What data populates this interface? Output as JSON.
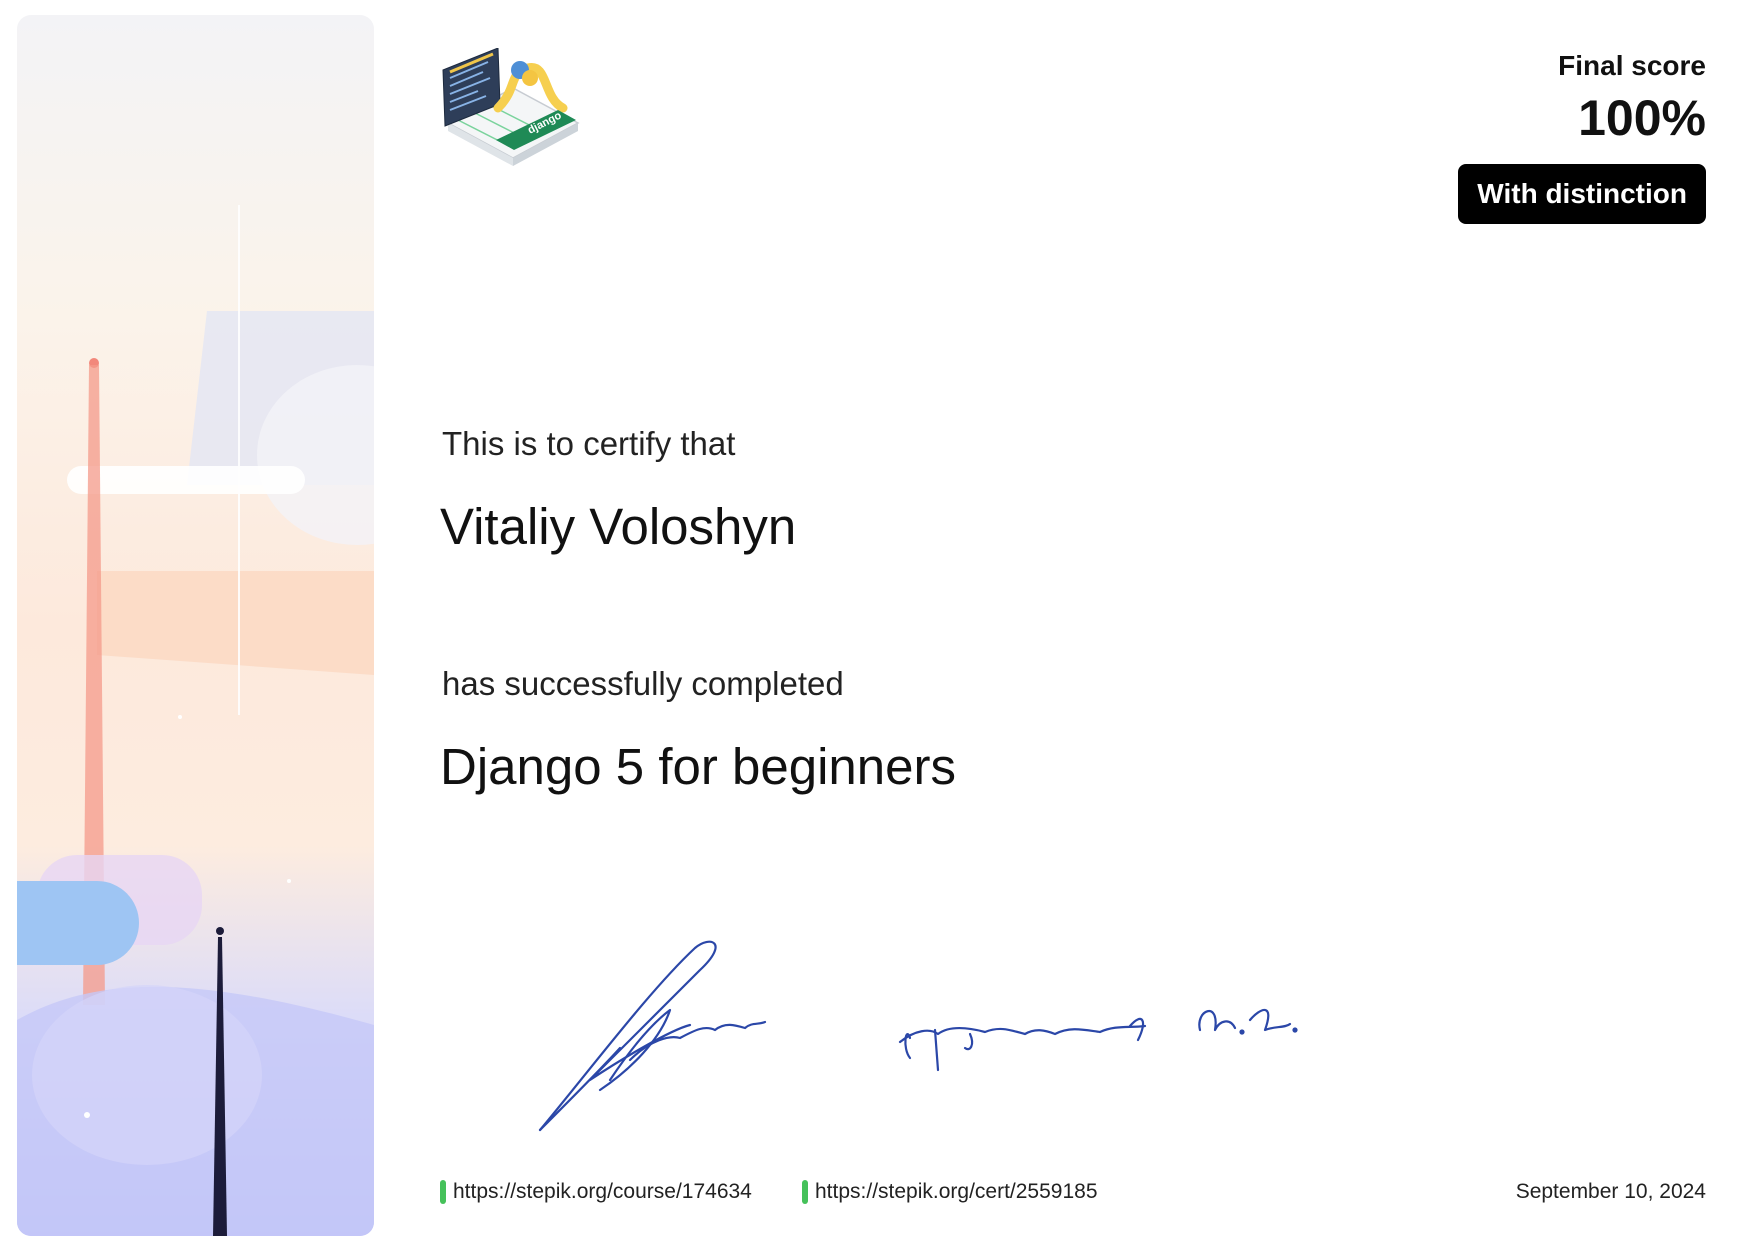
{
  "certificate": {
    "score_label": "Final score",
    "score_value": "100%",
    "distinction": "With distinction",
    "certify_text": "This is to certify that",
    "recipient": "Vitaliy Voloshyn",
    "completed_text": "has successfully completed",
    "course_title": "Django 5 for beginners",
    "course_url": "https://stepik.org/course/174634",
    "cert_url": "https://stepik.org/cert/2559185",
    "date": "September 10, 2024",
    "logo_text": "django"
  },
  "colors": {
    "accent_green": "#45c15a",
    "signature_ink": "#2b47a8",
    "badge_bg": "#000000"
  }
}
